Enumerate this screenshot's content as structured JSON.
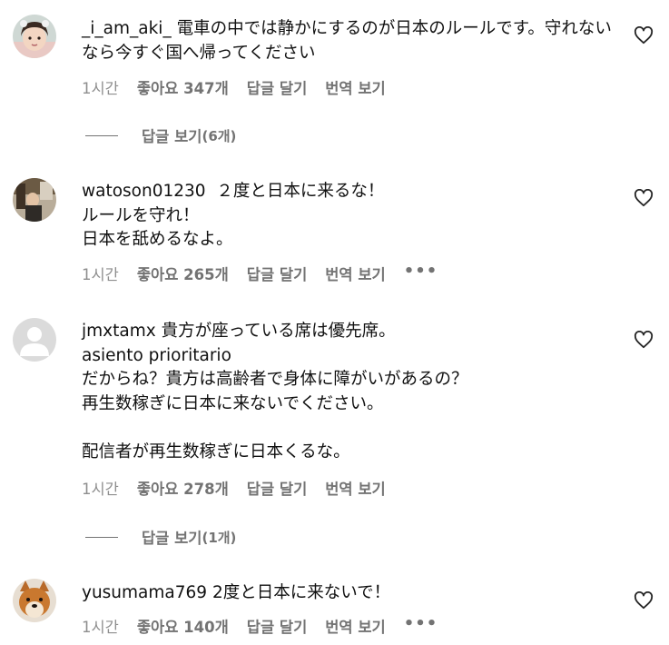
{
  "comments": [
    {
      "username": "_i_am_aki_",
      "text": "電車の中では静かにするのが日本のルールです。守れないなら今すぐ国へ帰ってください",
      "time": "1시간",
      "likes": "좋아요 347개",
      "reply": "답글 달기",
      "translate": "번역 보기",
      "view_replies": "답글 보기",
      "reply_count": "(6개)"
    },
    {
      "username": "watoson01230",
      "text": "２度と日本に来るな！\nルールを守れ！\n日本を舐めるなよ。",
      "time": "1시간",
      "likes": "좋아요 265개",
      "reply": "답글 달기",
      "translate": "번역 보기",
      "more": "•••"
    },
    {
      "username": "jmxtamx",
      "text": "貴方が座っている席は優先席。\nasiento prioritario\nだからね？貴方は高齢者で身体に障がいがあるの？\n再生数稼ぎに日本に来ないでください。\n\n配信者が再生数稼ぎに日本くるな。",
      "time": "1시간",
      "likes": "좋아요 278개",
      "reply": "답글 달기",
      "translate": "번역 보기",
      "view_replies": "답글 보기",
      "reply_count": "(1개)"
    },
    {
      "username": "yusumama769",
      "text": "2度と日本に来ないで！",
      "time": "1시간",
      "likes": "좋아요 140개",
      "reply": "답글 달기",
      "translate": "번역 보기",
      "more": "•••"
    }
  ],
  "icons": {
    "heart": "heart-outline-icon",
    "more": "more-horizontal-icon"
  },
  "colors": {
    "text": "#111111",
    "muted": "#737373",
    "background": "#ffffff"
  }
}
